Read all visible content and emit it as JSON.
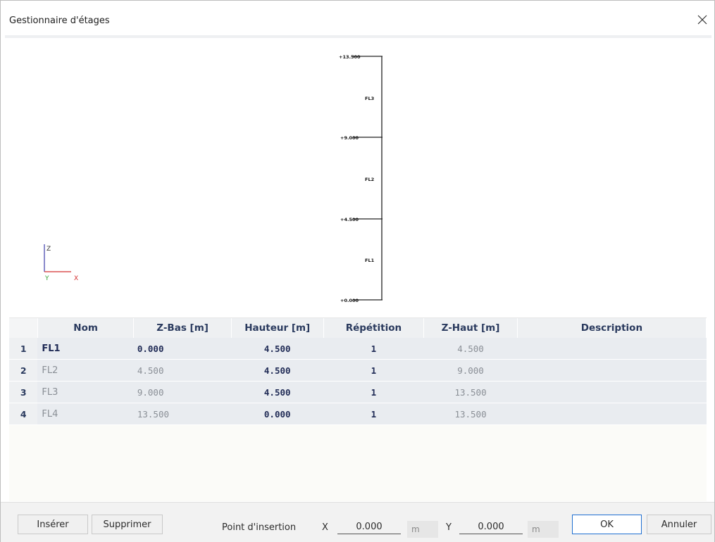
{
  "window": {
    "title": "Gestionnaire d'étages"
  },
  "diagram": {
    "levels": [
      {
        "label": "+13.500"
      },
      {
        "label": "+9.000"
      },
      {
        "label": "+4.500"
      },
      {
        "label": "+0.000"
      }
    ],
    "floor_labels": [
      "FL3",
      "FL2",
      "FL1"
    ],
    "axes": {
      "z": "Z",
      "y": "Y",
      "x": "X"
    }
  },
  "table": {
    "headers": [
      "Nom",
      "Z-Bas [m]",
      "Hauteur [m]",
      "Répétition",
      "Z-Haut [m]",
      "Description"
    ],
    "rows": [
      {
        "num": "1",
        "nom": "FL1",
        "zbas": "0.000",
        "hauteur": "4.500",
        "repetition": "1",
        "zhaut": "4.500",
        "description": ""
      },
      {
        "num": "2",
        "nom": "FL2",
        "zbas": "4.500",
        "hauteur": "4.500",
        "repetition": "1",
        "zhaut": "9.000",
        "description": ""
      },
      {
        "num": "3",
        "nom": "FL3",
        "zbas": "9.000",
        "hauteur": "4.500",
        "repetition": "1",
        "zhaut": "13.500",
        "description": ""
      },
      {
        "num": "4",
        "nom": "FL4",
        "zbas": "13.500",
        "hauteur": "0.000",
        "repetition": "1",
        "zhaut": "13.500",
        "description": ""
      }
    ]
  },
  "footer": {
    "insert_label": "Insérer",
    "delete_label": "Supprimer",
    "insertion_point_label": "Point d'insertion",
    "x_label": "X",
    "x_value": "0.000",
    "x_unit": "m",
    "y_label": "Y",
    "y_value": "0.000",
    "y_unit": "m",
    "ok_label": "OK",
    "cancel_label": "Annuler"
  }
}
